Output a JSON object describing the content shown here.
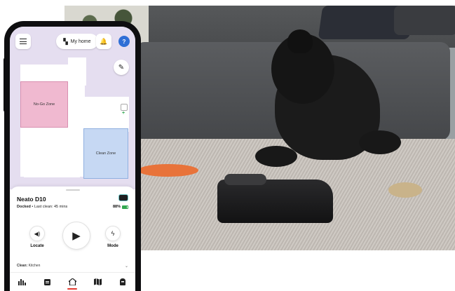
{
  "app": {
    "home_label": "My home",
    "help_label": "?"
  },
  "map": {
    "nogo_zone_label": "No-Go Zone",
    "clean_zone_label": "Clean Zone"
  },
  "robot": {
    "name": "Neato D10",
    "status_state": "Docked",
    "status_detail": "• Last clean: 45 mins",
    "battery_text": "88%",
    "battery_level": 0.88
  },
  "controls": {
    "locate_label": "Locate",
    "mode_label": "Mode"
  },
  "clean": {
    "label": "Clean:",
    "value": "Kitchen"
  },
  "tabs": [
    {
      "icon": "stats-icon"
    },
    {
      "icon": "schedule-icon"
    },
    {
      "icon": "home-icon",
      "active": true
    },
    {
      "icon": "map-icon"
    },
    {
      "icon": "robot-icon"
    }
  ],
  "colors": {
    "accent_blue": "#2f6fd6",
    "nogo_pink": "#f0b9d0",
    "clean_blue": "#c6d8f3",
    "battery_green": "#2fa84f",
    "active_tab_red": "#e33a2f"
  }
}
